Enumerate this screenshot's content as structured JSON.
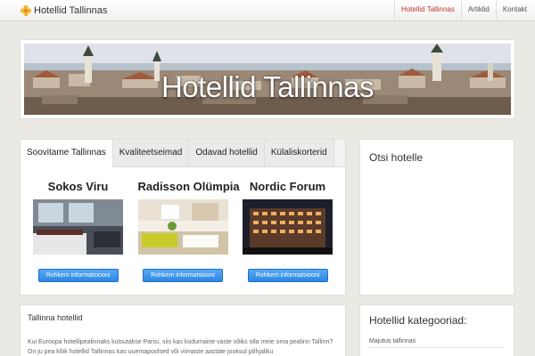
{
  "site": {
    "brand": "Hotellid Tallinnas",
    "brand_icon": "flower-icon",
    "accent": "#c0392b"
  },
  "nav": {
    "items": [
      {
        "label": "Hotellid Tallinnas",
        "active": true
      },
      {
        "label": "Artiklid",
        "active": false
      },
      {
        "label": "Kontakt",
        "active": false
      }
    ]
  },
  "banner": {
    "title": "Hotellid Tallinnas"
  },
  "tabs": [
    {
      "label": "Soovitame Tallinnas",
      "active": true
    },
    {
      "label": "Kvaliteetseimad",
      "active": false
    },
    {
      "label": "Odavad hotellid",
      "active": false
    },
    {
      "label": "Külaliskorterid",
      "active": false
    }
  ],
  "hotels": [
    {
      "name": "Sokos Viru",
      "button": "Rohkem informatsiooni"
    },
    {
      "name": "Radisson Olümpia",
      "button": "Rohkem informatsiooni"
    },
    {
      "name": "Nordic Forum",
      "button": "Rohkem informatsiooni"
    }
  ],
  "search_panel": {
    "title": "Otsi hotelle"
  },
  "article": {
    "title": "Tallinna hotellid",
    "text": "Kui Euroopa hotellipealinnaks kutsutakse Parisi, siis kas kodumaine vaste võiks olla meie oma pealinn Tallinn? On ju pea kõik hotellid Tallinnas kas uuemapoolsed või viimaste aastate jooksul põhjaliku"
  },
  "categories": {
    "title": "Hotellid kategooriad:",
    "items": [
      "Majutus tallinnas"
    ]
  }
}
